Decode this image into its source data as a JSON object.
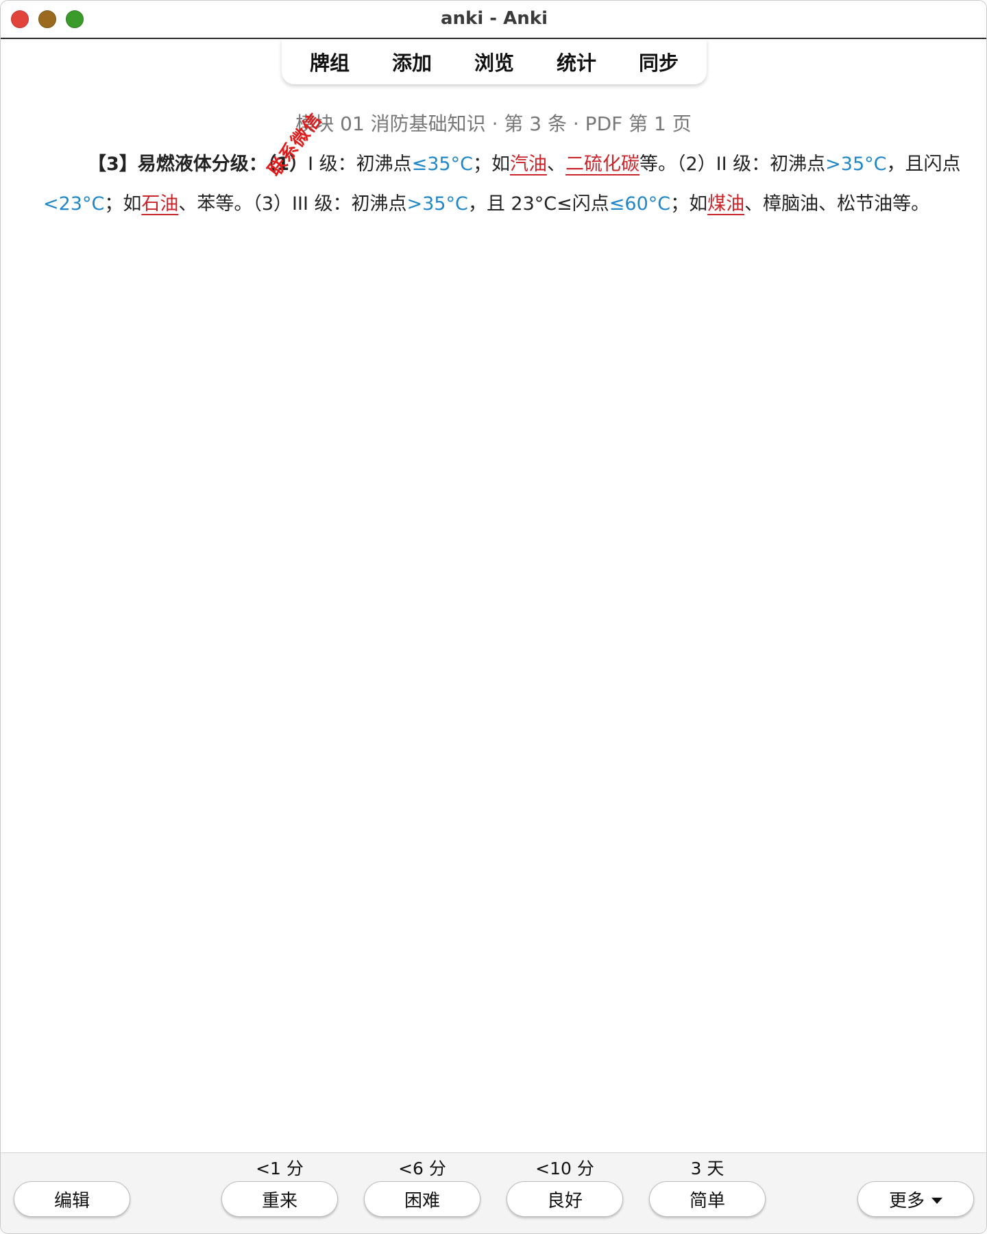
{
  "window": {
    "title": "anki - Anki"
  },
  "toolbar": {
    "items": [
      "牌组",
      "添加",
      "浏览",
      "统计",
      "同步"
    ]
  },
  "card": {
    "info": "模块 01 消防基础知识 · 第 3 条 · PDF 第 1 页",
    "line1": {
      "t1": "【3】易燃液体分级：（1）",
      "t2": "I 级：初沸点",
      "b1": "≤35°C",
      "t3": "；如",
      "r1": "汽油",
      "t4": "、",
      "r2": "二硫化碳",
      "t5": "等。（2）II 级：初沸点",
      "b2": ">35°C",
      "t6": "，且闪点"
    },
    "line2": {
      "b1": "<23°C",
      "t1": "；如",
      "r1": "石油",
      "t2": "、苯等。（3）III 级：初沸点",
      "b2": ">35°C",
      "t3": "，且 23°C≤闪点",
      "b3": "≤60°C",
      "t4": "；如",
      "r2": "煤油",
      "t5": "、樟脑油、松节油等。"
    },
    "watermark": "联系微信"
  },
  "answer_bar": {
    "edit": "编辑",
    "more": "更多",
    "buttons": [
      {
        "label": "重来",
        "interval": "<1 分"
      },
      {
        "label": "困难",
        "interval": "<6 分"
      },
      {
        "label": "良好",
        "interval": "<10 分"
      },
      {
        "label": "简单",
        "interval": "3 天"
      }
    ]
  },
  "colors": {
    "accent_blue": "#1f86c8",
    "highlight_red": "#c8242a"
  }
}
